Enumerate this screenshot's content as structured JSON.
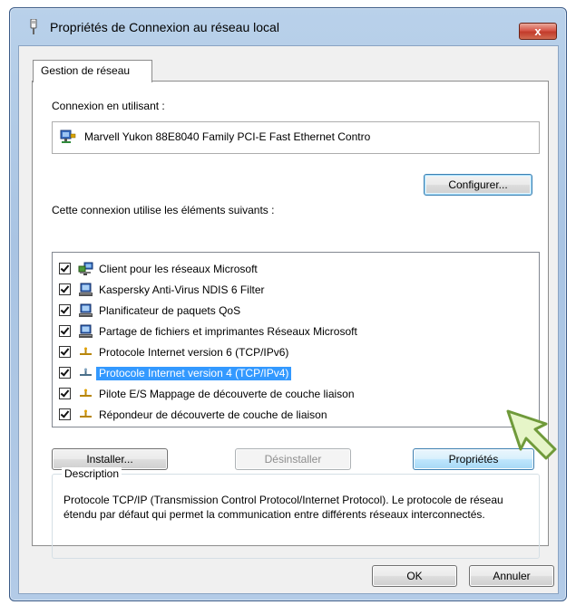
{
  "window": {
    "title": "Propriétés de Connexion au réseau local",
    "close_label": "x"
  },
  "tabs": [
    {
      "label": "Gestion de réseau",
      "selected": true
    }
  ],
  "connection": {
    "label": "Connexion en utilisant :",
    "adapter": "Marvell Yukon 88E8040 Family PCI-E Fast Ethernet Contro",
    "configure_button": "Configurer..."
  },
  "items_section": {
    "label": "Cette connexion utilise les éléments suivants :",
    "items": [
      {
        "label": "Client pour les réseaux Microsoft",
        "checked": true,
        "icon": "network-client-icon"
      },
      {
        "label": "Kaspersky Anti-Virus NDIS 6 Filter",
        "checked": true,
        "icon": "service-icon"
      },
      {
        "label": "Planificateur de paquets QoS",
        "checked": true,
        "icon": "service-icon"
      },
      {
        "label": "Partage de fichiers et imprimantes Réseaux Microsoft",
        "checked": true,
        "icon": "service-icon"
      },
      {
        "label": "Protocole Internet version 6 (TCP/IPv6)",
        "checked": true,
        "icon": "protocol-icon"
      },
      {
        "label": "Protocole Internet version 4 (TCP/IPv4)",
        "checked": true,
        "icon": "protocol-icon",
        "selected": true
      },
      {
        "label": "Pilote E/S Mappage de découverte de couche liaison",
        "checked": true,
        "icon": "protocol-icon"
      },
      {
        "label": "Répondeur de découverte de couche de liaison",
        "checked": true,
        "icon": "protocol-icon"
      }
    ]
  },
  "actions": {
    "install": "Installer...",
    "uninstall": "Désinstaller",
    "properties": "Propriétés"
  },
  "description": {
    "legend": "Description",
    "text": "Protocole TCP/IP (Transmission Control Protocol/Internet Protocol). Le protocole de réseau étendu par défaut qui permet la communication entre différents réseaux interconnectés."
  },
  "footer": {
    "ok": "OK",
    "cancel": "Annuler"
  },
  "colors": {
    "selection": "#3399ff",
    "titlebar": "#b9d1ea",
    "close_button": "#c23b2b"
  }
}
